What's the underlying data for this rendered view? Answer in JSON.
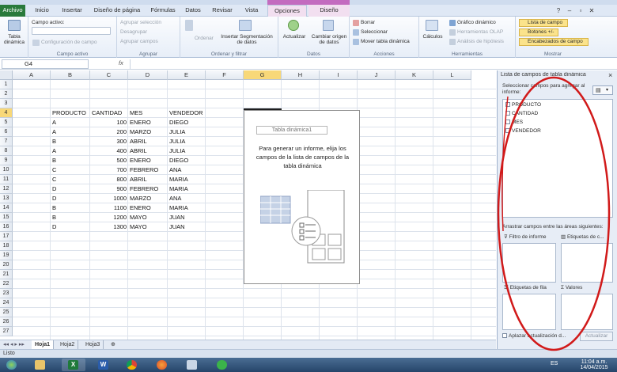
{
  "tabs": [
    {
      "label": "Archivo"
    },
    {
      "label": "Inicio"
    },
    {
      "label": "Insertar"
    },
    {
      "label": "Diseño de página"
    },
    {
      "label": "Fórmulas"
    },
    {
      "label": "Datos"
    },
    {
      "label": "Revisar"
    },
    {
      "label": "Vista"
    },
    {
      "label": "Opciones"
    },
    {
      "label": "Diseño"
    }
  ],
  "ribbon": {
    "pivot_table": {
      "big_label_1": "Tabla",
      "big_label_2": "dinámica",
      "group": ""
    },
    "active_field": {
      "label": "Campo activo:",
      "settings": "Configuración de campo",
      "group": "Campo activo"
    },
    "group_section": {
      "group_selection": "Agrupar selección",
      "ungroup": "Desagrupar",
      "group_field": "Agrupar campos",
      "group": "Agrupar"
    },
    "sort_filter": {
      "sort": "Ordenar",
      "insert_slicer_1": "Insertar Segmentación",
      "insert_slicer_2": "de datos",
      "group": "Ordenar y filtrar"
    },
    "data": {
      "refresh": "Actualizar",
      "change_source_1": "Cambiar origen",
      "change_source_2": "de datos",
      "group": "Datos"
    },
    "actions": {
      "clear": "Borrar",
      "select": "Seleccionar",
      "move": "Mover tabla dinámica",
      "group": "Acciones"
    },
    "tools": {
      "calculations": "Cálculos",
      "pivot_chart": "Gráfico dinámico",
      "olap": "Herramientas OLAP",
      "whatif": "Análisis de hipótesis",
      "group": "Herramientas"
    },
    "show": {
      "field_list": "Lista de campo",
      "buttons": "Botones +/-",
      "headers": "Encabezados de campo",
      "group": "Mostrar"
    }
  },
  "formula_bar": {
    "name_box": "G4",
    "fx": "fx",
    "formula": ""
  },
  "columns": [
    "A",
    "B",
    "C",
    "D",
    "E",
    "F",
    "G",
    "H",
    "I",
    "J",
    "K",
    "L"
  ],
  "selected_column": "G",
  "rows": [
    "1",
    "2",
    "3",
    "4",
    "5",
    "6",
    "7",
    "8",
    "9",
    "10",
    "11",
    "12",
    "13",
    "14",
    "15",
    "16",
    "17",
    "18",
    "19",
    "20",
    "21",
    "22",
    "23",
    "24",
    "25",
    "26",
    "27"
  ],
  "selected_row": "4",
  "table": {
    "headers": [
      "PRODUCTO",
      "CANTIDAD",
      "MES",
      "VENDEDOR"
    ],
    "rows": [
      [
        "A",
        "100",
        "ENERO",
        "DIEGO"
      ],
      [
        "A",
        "200",
        "MARZO",
        "JULIA"
      ],
      [
        "B",
        "300",
        "ABRIL",
        "JULIA"
      ],
      [
        "A",
        "400",
        "ABRIL",
        "JULIA"
      ],
      [
        "B",
        "500",
        "ENERO",
        "DIEGO"
      ],
      [
        "C",
        "700",
        "FEBRERO",
        "ANA"
      ],
      [
        "C",
        "800",
        "ABRIL",
        "MARIA"
      ],
      [
        "D",
        "900",
        "FEBRERO",
        "MARIA"
      ],
      [
        "D",
        "1000",
        "MARZO",
        "ANA"
      ],
      [
        "B",
        "1100",
        "ENERO",
        "MARIA"
      ],
      [
        "B",
        "1200",
        "MAYO",
        "JUAN"
      ],
      [
        "D",
        "1300",
        "MAYO",
        "JUAN"
      ]
    ]
  },
  "pivot_placeholder": {
    "title": "Tabla dinámica1",
    "message": "Para generar un informe, elija los campos de la lista de campos de la tabla dinámica"
  },
  "sheet_tabs": [
    "Hoja1",
    "Hoja2",
    "Hoja3"
  ],
  "active_sheet": "Hoja1",
  "status": "Listo",
  "field_pane": {
    "title": "Lista de campos de tabla dinámica",
    "choose": "Seleccionar campos para agregar al informe:",
    "fields": [
      "PRODUCTO",
      "CANTIDAD",
      "MES",
      "VENDEDOR"
    ],
    "drag_hint": "Arrastrar campos entre las áreas siguientes:",
    "report_filter": "Filtro de informe",
    "column_labels": "Etiquetas de c...",
    "row_labels": "Etiquetas de fila",
    "values": "Valores",
    "defer": "Aplazar actualización d...",
    "update": "Actualizar"
  },
  "taskbar": {
    "lang": "ES",
    "time": "11:04 a.m.",
    "date": "14/04/2015"
  },
  "colors": {
    "file_tab": "#2a7a3b",
    "annotation": "#d11a1a",
    "selected_header": "#f8d878"
  }
}
